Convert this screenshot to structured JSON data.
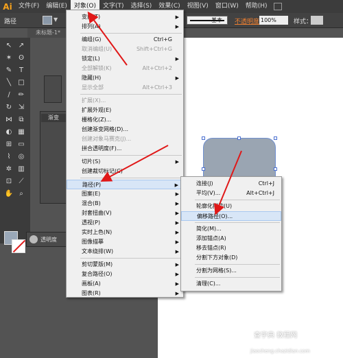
{
  "app": {
    "logo": "Ai"
  },
  "menubar": {
    "items": [
      "文件(F)",
      "编辑(E)",
      "对象(O)",
      "文字(T)",
      "选择(S)",
      "效果(C)",
      "视图(V)",
      "窗口(W)",
      "帮助(H)"
    ],
    "active_index": 2
  },
  "controlbar": {
    "label": "路径",
    "stroke_style": "基本",
    "opacity_label": "不透明度",
    "opacity_value": "100%",
    "style_label": "样式："
  },
  "document_tab": {
    "title": "未标题-1*"
  },
  "panels": {
    "gradient_title": "渐变",
    "gradient_type": "类",
    "transparency_title": "透明度"
  },
  "object_menu": {
    "items": [
      {
        "label": "变换(T)",
        "shortcut": "",
        "submenu": true,
        "enabled": true
      },
      {
        "label": "排列(A)",
        "shortcut": "",
        "submenu": true,
        "enabled": true
      },
      {
        "label": "编组(G)",
        "shortcut": "Ctrl+G",
        "submenu": false,
        "enabled": true
      },
      {
        "label": "取消编组(U)",
        "shortcut": "Shift+Ctrl+G",
        "submenu": false,
        "enabled": false
      },
      {
        "label": "锁定(L)",
        "shortcut": "",
        "submenu": true,
        "enabled": true
      },
      {
        "label": "全部解锁(K)",
        "shortcut": "Alt+Ctrl+2",
        "submenu": false,
        "enabled": false
      },
      {
        "label": "隐藏(H)",
        "shortcut": "",
        "submenu": true,
        "enabled": true
      },
      {
        "label": "显示全部",
        "shortcut": "Alt+Ctrl+3",
        "submenu": false,
        "enabled": false
      },
      {
        "label": "扩展(X)...",
        "shortcut": "",
        "submenu": false,
        "enabled": false
      },
      {
        "label": "扩展外观(E)",
        "shortcut": "",
        "submenu": false,
        "enabled": true
      },
      {
        "label": "栅格化(Z)...",
        "shortcut": "",
        "submenu": false,
        "enabled": true
      },
      {
        "label": "创建渐变网格(D)...",
        "shortcut": "",
        "submenu": false,
        "enabled": true
      },
      {
        "label": "创建对象马赛克(J)...",
        "shortcut": "",
        "submenu": false,
        "enabled": false
      },
      {
        "label": "拼合透明度(F)...",
        "shortcut": "",
        "submenu": false,
        "enabled": true
      },
      {
        "label": "切片(S)",
        "shortcut": "",
        "submenu": true,
        "enabled": true
      },
      {
        "label": "创建裁切标记(C)",
        "shortcut": "",
        "submenu": false,
        "enabled": true
      },
      {
        "label": "路径(P)",
        "shortcut": "",
        "submenu": true,
        "enabled": true,
        "highlighted": true
      },
      {
        "label": "图案(E)",
        "shortcut": "",
        "submenu": true,
        "enabled": true
      },
      {
        "label": "混合(B)",
        "shortcut": "",
        "submenu": true,
        "enabled": true
      },
      {
        "label": "封套扭曲(V)",
        "shortcut": "",
        "submenu": true,
        "enabled": true
      },
      {
        "label": "透视(P)",
        "shortcut": "",
        "submenu": true,
        "enabled": true
      },
      {
        "label": "实时上色(N)",
        "shortcut": "",
        "submenu": true,
        "enabled": true
      },
      {
        "label": "图像描摹",
        "shortcut": "",
        "submenu": true,
        "enabled": true
      },
      {
        "label": "文本绕排(W)",
        "shortcut": "",
        "submenu": true,
        "enabled": true
      },
      {
        "label": "剪切蒙版(M)",
        "shortcut": "",
        "submenu": true,
        "enabled": true
      },
      {
        "label": "复合路径(O)",
        "shortcut": "",
        "submenu": true,
        "enabled": true
      },
      {
        "label": "画板(A)",
        "shortcut": "",
        "submenu": true,
        "enabled": true
      },
      {
        "label": "图表(R)",
        "shortcut": "",
        "submenu": true,
        "enabled": true
      }
    ]
  },
  "path_submenu": {
    "items": [
      {
        "label": "连接(J)",
        "shortcut": "Ctrl+J"
      },
      {
        "label": "平均(V)...",
        "shortcut": "Alt+Ctrl+J"
      },
      {
        "label": "轮廓化描边(U)",
        "shortcut": ""
      },
      {
        "label": "偏移路径(O)...",
        "shortcut": "",
        "highlighted": true
      },
      {
        "label": "简化(M)...",
        "shortcut": ""
      },
      {
        "label": "添加锚点(A)",
        "shortcut": ""
      },
      {
        "label": "移去锚点(R)",
        "shortcut": ""
      },
      {
        "label": "分割下方对象(D)",
        "shortcut": ""
      },
      {
        "label": "分割为网格(S)...",
        "shortcut": ""
      },
      {
        "label": "清理(C)...",
        "shortcut": ""
      }
    ]
  },
  "watermark": {
    "line1": "查字典 教程网",
    "line2": "jiaocheng.chazidian.com"
  },
  "colors": {
    "accent": "#f7a21b",
    "arrow": "#e01818",
    "selection": "#4a6fd0",
    "shape_fill": "#9aa5b2"
  }
}
